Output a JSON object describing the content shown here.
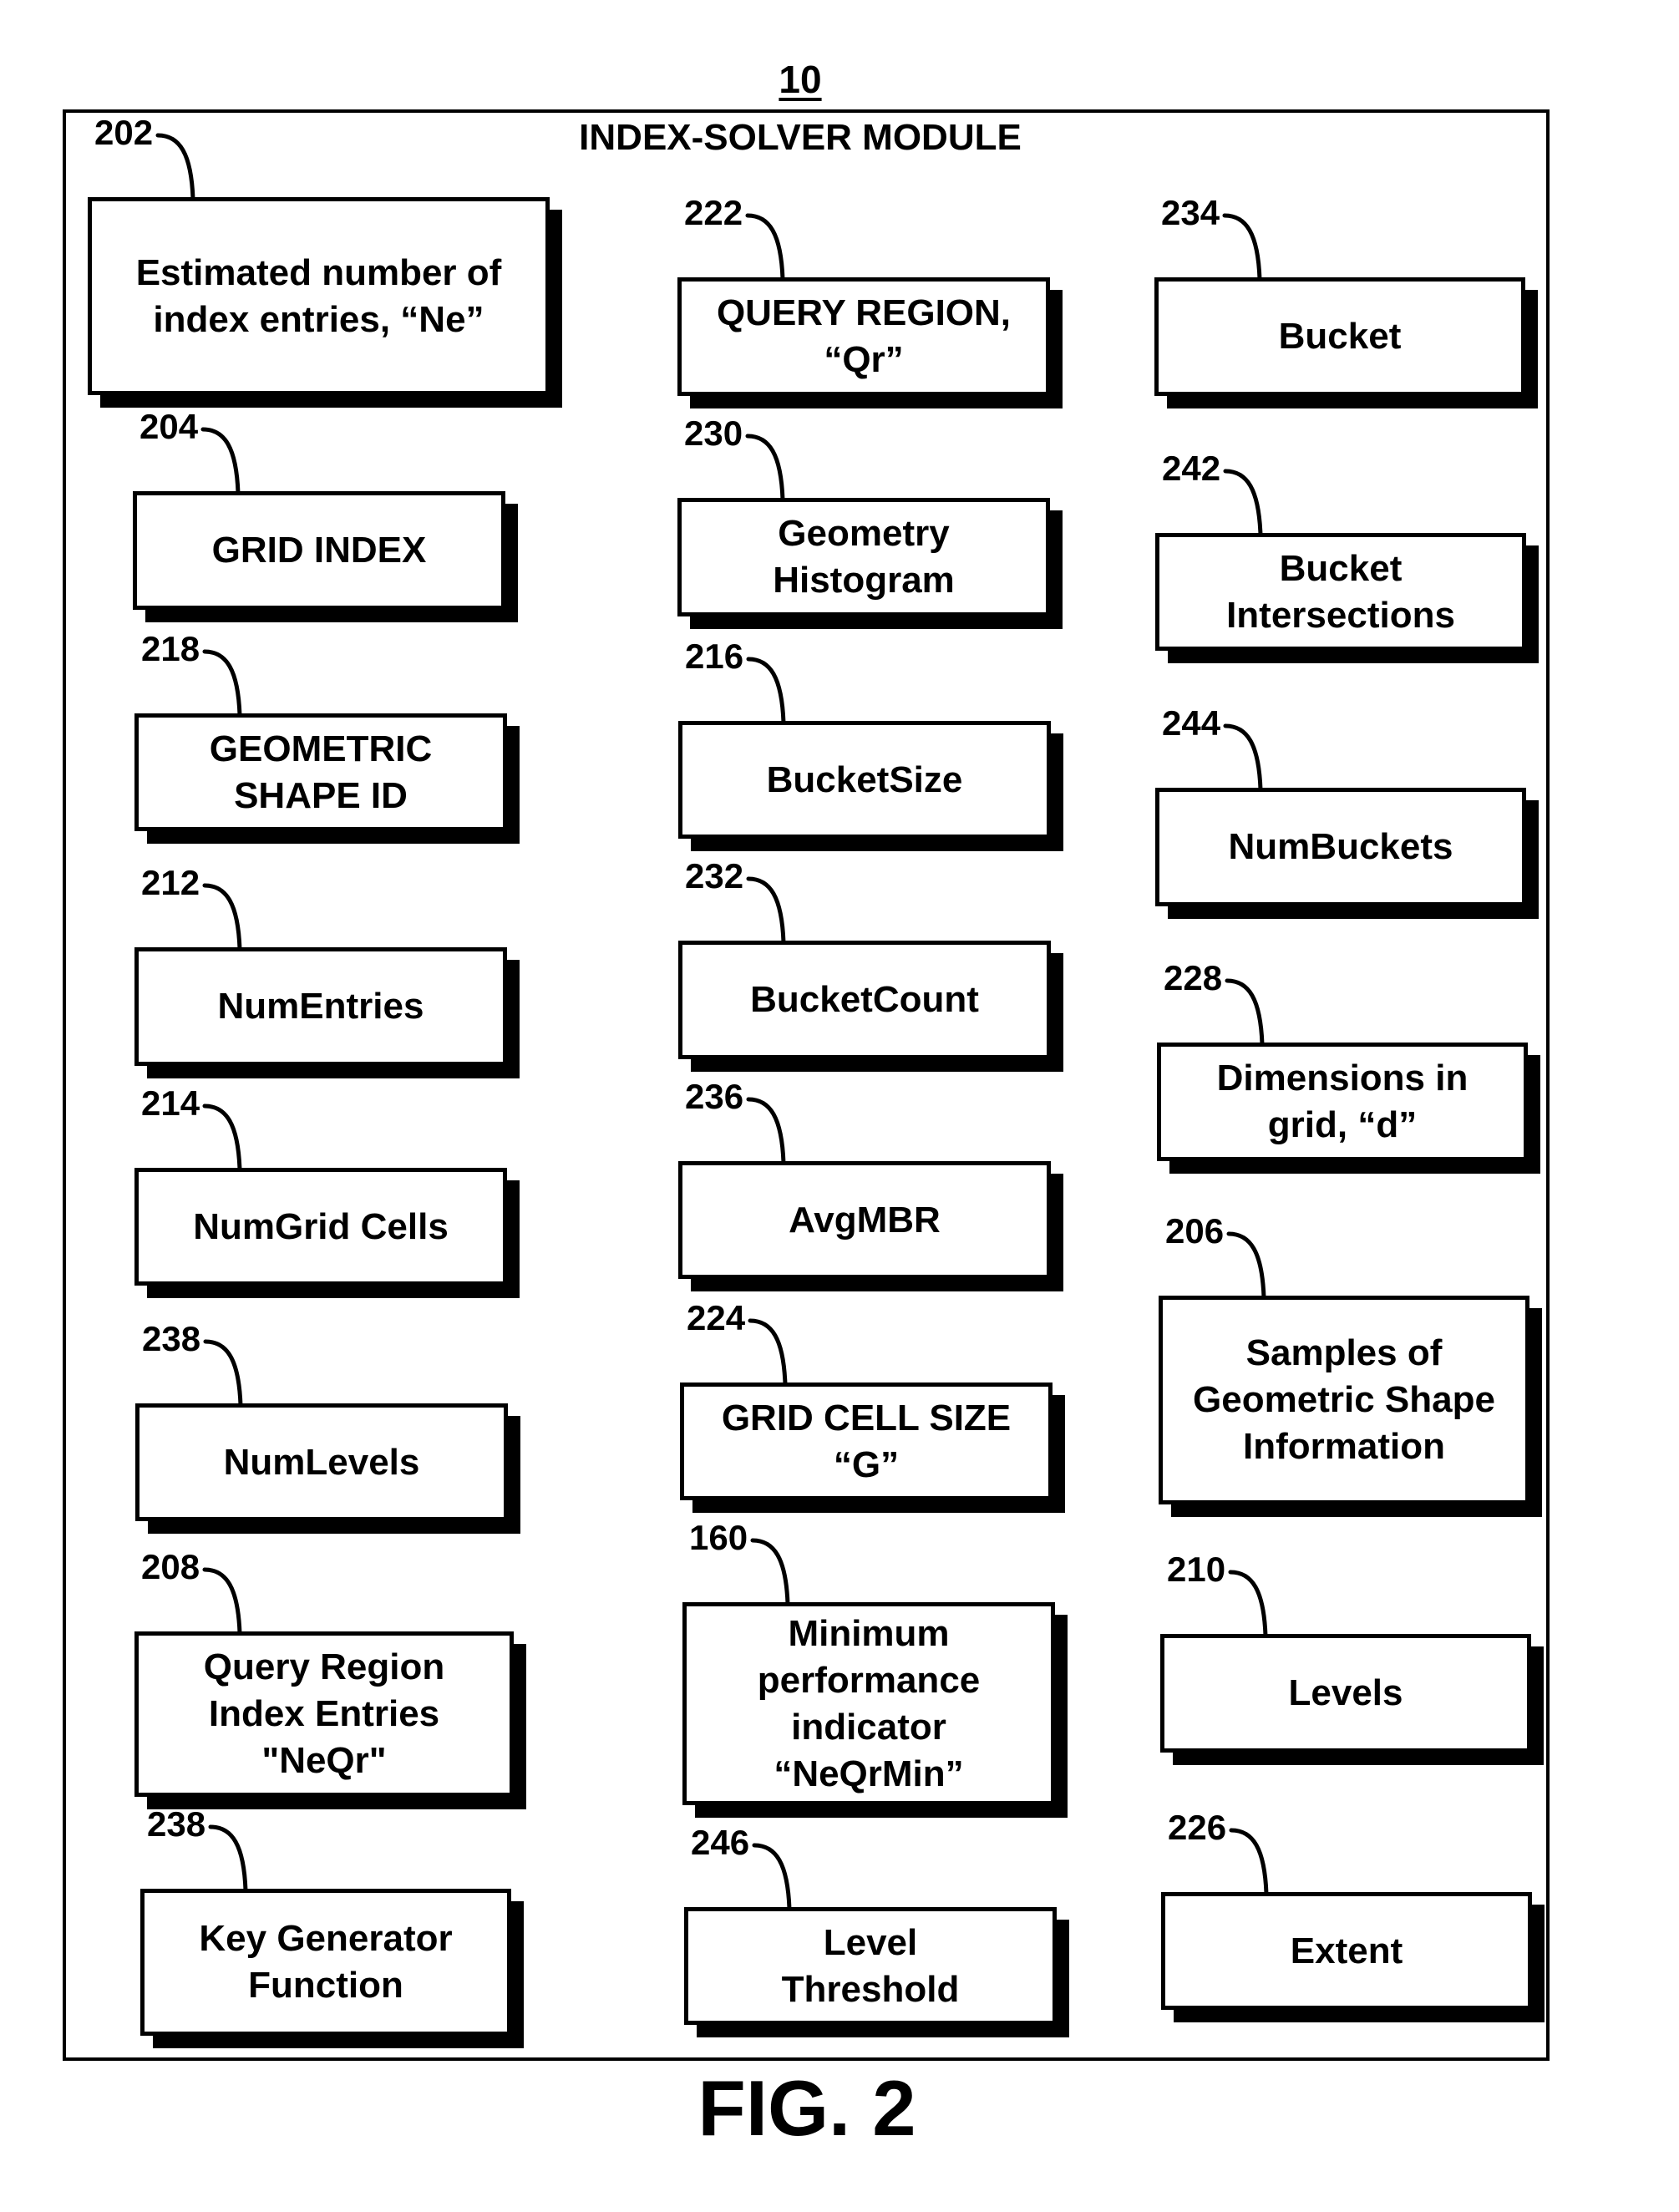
{
  "figure": {
    "number": "10",
    "module_title": "INDEX-SOLVER MODULE",
    "caption": "FIG. 2"
  },
  "columns": [
    {
      "items": [
        {
          "ref": "202",
          "label": "Estimated number of\nindex entries, “Ne”"
        },
        {
          "ref": "204",
          "label": "GRID INDEX"
        },
        {
          "ref": "218",
          "label": "GEOMETRIC\nSHAPE ID"
        },
        {
          "ref": "212",
          "label": "NumEntries"
        },
        {
          "ref": "214",
          "label": "NumGrid Cells"
        },
        {
          "ref": "238",
          "label": "NumLevels"
        },
        {
          "ref": "208",
          "label": "Query Region\nIndex Entries\n\"NeQr\""
        },
        {
          "ref": "238",
          "label": "Key Generator\nFunction"
        }
      ]
    },
    {
      "items": [
        {
          "ref": "222",
          "label": "QUERY REGION,\n“Qr”"
        },
        {
          "ref": "230",
          "label": "Geometry\nHistogram"
        },
        {
          "ref": "216",
          "label": "BucketSize"
        },
        {
          "ref": "232",
          "label": "BucketCount"
        },
        {
          "ref": "236",
          "label": "AvgMBR"
        },
        {
          "ref": "224",
          "label": "GRID CELL SIZE\n“G”"
        },
        {
          "ref": "160",
          "label": "Minimum\nperformance\nindicator\n“NeQrMin”"
        },
        {
          "ref": "246",
          "label": "Level\nThreshold"
        }
      ]
    },
    {
      "items": [
        {
          "ref": "234",
          "label": "Bucket"
        },
        {
          "ref": "242",
          "label": "Bucket\nIntersections"
        },
        {
          "ref": "244",
          "label": "NumBuckets"
        },
        {
          "ref": "228",
          "label": "Dimensions in\ngrid, “d”"
        },
        {
          "ref": "206",
          "label": "Samples of\nGeometric Shape\nInformation"
        },
        {
          "ref": "210",
          "label": "Levels"
        },
        {
          "ref": "226",
          "label": "Extent"
        }
      ]
    }
  ]
}
